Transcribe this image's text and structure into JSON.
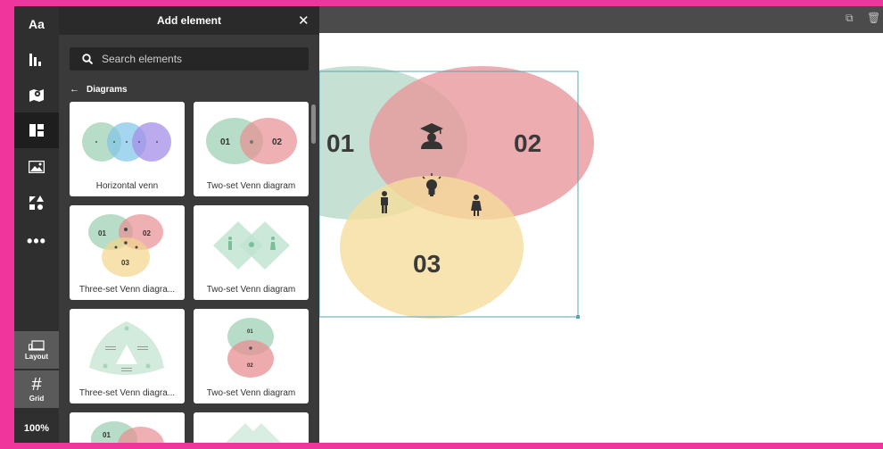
{
  "rail": {
    "text_tool": "Aa",
    "layout_label": "Layout",
    "grid_label": "Grid",
    "zoom": "100%"
  },
  "panel": {
    "title": "Add element",
    "close": "✕",
    "search_placeholder": "Search elements",
    "back_label": "Diagrams",
    "items": [
      {
        "label": "Horizontal venn"
      },
      {
        "label": "Two-set Venn diagram"
      },
      {
        "label": "Three-set Venn diagra..."
      },
      {
        "label": "Two-set Venn diagram"
      },
      {
        "label": "Three-set Venn diagra..."
      },
      {
        "label": "Two-set Venn diagram"
      }
    ],
    "thumb_text": {
      "t2_left": "01",
      "t2_right": "02",
      "t3_a": "01",
      "t3_b": "02",
      "t3_c": "03",
      "t6_top": "01",
      "t6_bottom": "02",
      "t7_a": "01"
    }
  },
  "canvas": {
    "venn": {
      "label_1": "01",
      "label_2": "02",
      "label_3": "03",
      "colors": {
        "green": "#bcdccb",
        "red": "#e8969a",
        "yellow": "#f5dd9b"
      }
    }
  }
}
